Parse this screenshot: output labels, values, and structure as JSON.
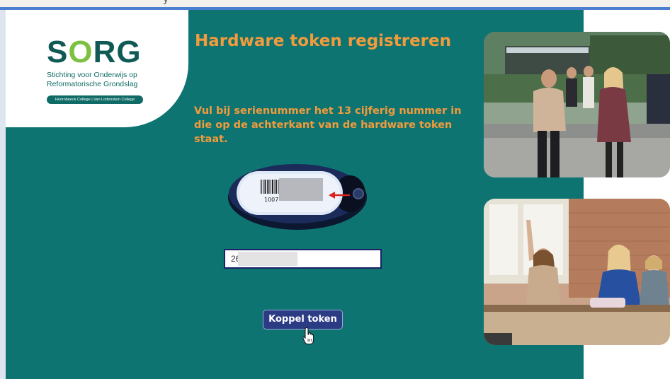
{
  "browser": {
    "partial_text": "y"
  },
  "logo": {
    "name_parts": [
      "S",
      "O",
      "RG"
    ],
    "subtitle_line1": "Stichting voor Onderwijs op",
    "subtitle_line2": "Reformatorische Grondslag",
    "badge": "Hoornbeeck College | Van Lodenstein College"
  },
  "page": {
    "title": "Hardware token registreren",
    "instruction": "Vul bij serienummer het 13 cijferig nummer in die op de achterkant van de hardware token staat."
  },
  "token": {
    "barcode_number": "1007"
  },
  "serial_input": {
    "value": "26"
  },
  "actions": {
    "koppel_label": "Koppel token"
  },
  "colors": {
    "panel_background": "#0e7471",
    "title_accent": "#f19b3c",
    "button": "#2c3c84",
    "logo_dark": "#0f5a55",
    "logo_green": "#7cc142"
  },
  "icons": {
    "cursor": "hand-pointer-icon",
    "arrow": "red-arrow-icon"
  }
}
